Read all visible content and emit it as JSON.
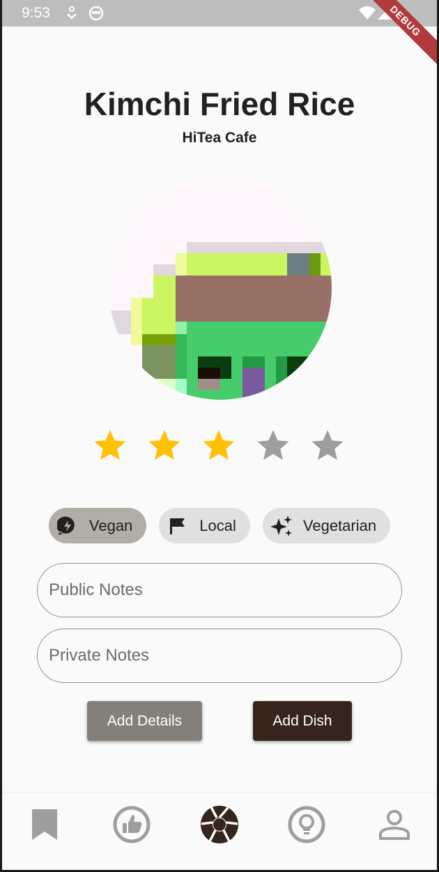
{
  "status_bar": {
    "time": "9:53",
    "icons": [
      "download-icon",
      "face-icon",
      "wifi-icon",
      "signal-icon",
      "battery-icon"
    ],
    "debug_label": "DEBUG"
  },
  "dish": {
    "name": "Kimchi Fried Rice",
    "restaurant": "HiTea Cafe"
  },
  "rating": {
    "value": 3,
    "max": 5,
    "active_color": "#ffc107",
    "inactive_color": "#9e9e9e"
  },
  "tags": [
    {
      "label": "Vegan",
      "icon": "eco-bolt-icon",
      "selected": true
    },
    {
      "label": "Local",
      "icon": "flag-icon",
      "selected": false
    },
    {
      "label": "Vegetarian",
      "icon": "sparkle-icon",
      "selected": false
    }
  ],
  "form": {
    "public_notes": {
      "placeholder": "Public Notes",
      "value": ""
    },
    "private_notes": {
      "placeholder": "Private Notes",
      "value": ""
    }
  },
  "actions": {
    "add_details": "Add Details",
    "add_dish": "Add Dish"
  },
  "bottom_nav": {
    "items": [
      "bookmark-icon",
      "thumb-up-icon",
      "camera-shutter-icon",
      "lightbulb-icon",
      "person-icon"
    ],
    "active_index": 2,
    "active_color": "#35251c",
    "inactive_color": "#9e9e9e"
  }
}
